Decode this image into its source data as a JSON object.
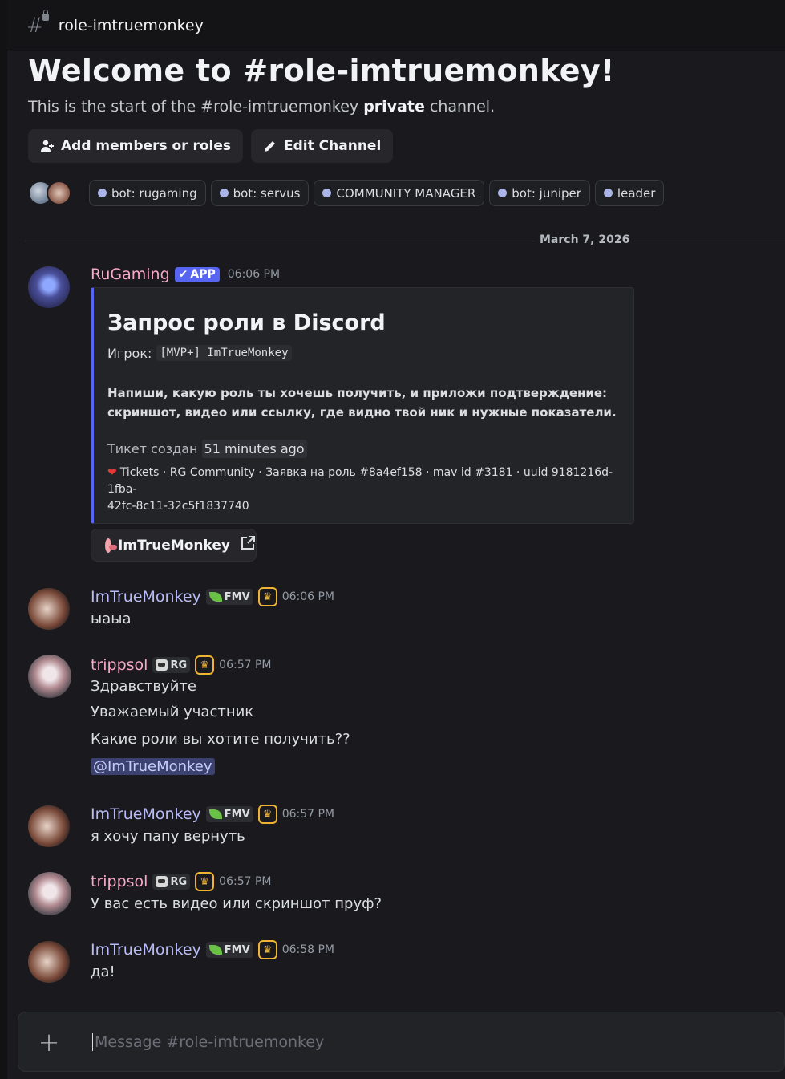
{
  "header": {
    "channel_name": "role-imtruemonkey",
    "icon": "hash-lock-icon"
  },
  "welcome": {
    "title": "Welcome to #role-imtruemonkey!",
    "sub_prefix": "This is the start of the #role-imtruemonkey ",
    "sub_bold": "private",
    "sub_suffix": " channel.",
    "add_members_label": "Add members or roles",
    "edit_channel_label": "Edit Channel",
    "roles": [
      "bot: rugaming",
      "bot: servus",
      "COMMUNITY MANAGER",
      "bot: juniper",
      "leader"
    ]
  },
  "date_divider": "March 7, 2026",
  "messages": [
    {
      "author": "RuGaming",
      "author_color": "#f9a8c8",
      "badge": "APP",
      "time": "06:06 PM",
      "embed": {
        "title": "Запрос роли в Discord",
        "field_label": "Игрок:",
        "field_value": "[MVP+] ImTrueMonkey",
        "description_line1": "Напиши, какую роль ты хочешь получить, и приложи подтверждение:",
        "description_line2": "скриншот, видео или ссылку, где видно твой ник и нужные показатели.",
        "ticket_label": "Тикет создан",
        "ticket_ago": "51 minutes ago",
        "footer_line1": "Tickets · RG Community · Заявка на роль #8a4ef158 · mav id #3181 · uuid 9181216d-1fba-",
        "footer_line2": "42fc-8c11-32c5f1837740"
      },
      "link_button": "ImTrueMonkey"
    },
    {
      "author": "ImTrueMonkey",
      "author_color": "#b9bcf6",
      "tag": "FMV",
      "time": "06:06 PM",
      "lines": [
        "ыаыа"
      ]
    },
    {
      "author": "trippsol",
      "author_color": "#f9a8c8",
      "tag": "RG",
      "time": "06:57 PM",
      "lines": [
        "Здравствуйте",
        "Уважаемый участник",
        "Какие роли вы хотите получить??"
      ],
      "mention": "@ImTrueMonkey"
    },
    {
      "author": "ImTrueMonkey",
      "author_color": "#b9bcf6",
      "tag": "FMV",
      "time": "06:57 PM",
      "lines": [
        "я хочу папу вернуть"
      ]
    },
    {
      "author": "trippsol",
      "author_color": "#f9a8c8",
      "tag": "RG",
      "time": "06:57 PM",
      "lines": [
        "У вас есть видео или скриншот пруф?"
      ]
    },
    {
      "author": "ImTrueMonkey",
      "author_color": "#b9bcf6",
      "tag": "FMV",
      "time": "06:58 PM",
      "lines": [
        "да!"
      ]
    }
  ],
  "composer": {
    "placeholder": "Message #role-imtruemonkey"
  }
}
